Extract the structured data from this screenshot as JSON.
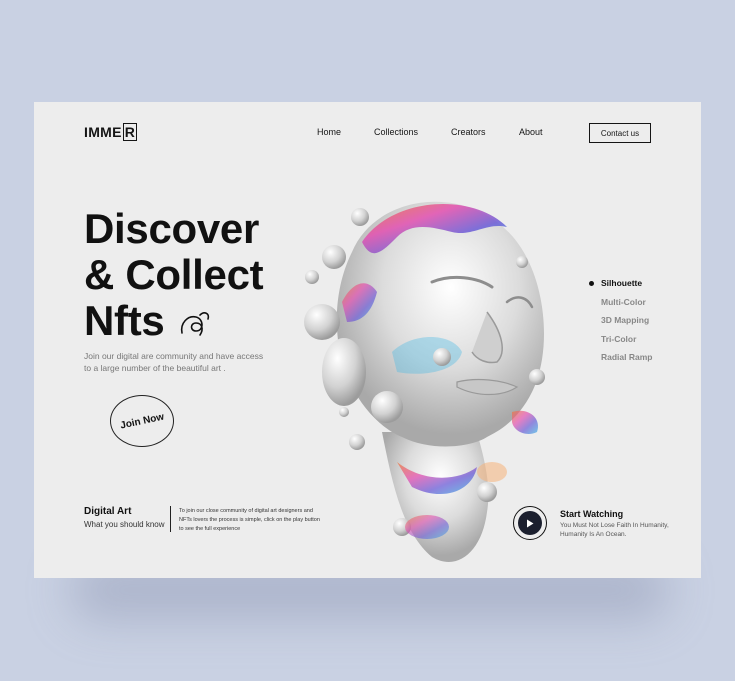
{
  "brand": {
    "logo_main": "IMME",
    "logo_boxed": "R"
  },
  "nav": {
    "items": [
      "Home",
      "Collections",
      "Creators",
      "About"
    ],
    "contact_label": "Contact us"
  },
  "hero": {
    "lines": [
      "Discover",
      "& Collect",
      "Nfts"
    ],
    "subtitle": "Join our digital are community and have access to a large number of the beautiful art .",
    "join_label": "Join Now"
  },
  "digital": {
    "title": "Digital Art",
    "subtitle": "What you should know",
    "text": "To join our close community of digital art designers and NFTs lovers the process is simple, click on the play button to see the full experience"
  },
  "styles": {
    "items": [
      "Silhouette",
      "Multi-Color",
      "3D Mapping",
      "Tri-Color",
      "Radial Ramp"
    ],
    "active_index": 0
  },
  "watch": {
    "title": "Start Watching",
    "text": "You Must Not Lose Faith In Humanity, Humanity Is An Ocean."
  },
  "icons": {
    "swirl": "swirl-icon",
    "play": "play-icon",
    "head": "sculpture-head-image"
  },
  "colors": {
    "page_bg": "#c9d1e3",
    "card_bg": "#ededed",
    "text_dark": "#111111",
    "text_muted": "#888888",
    "play_fill": "#1b1f2e"
  }
}
